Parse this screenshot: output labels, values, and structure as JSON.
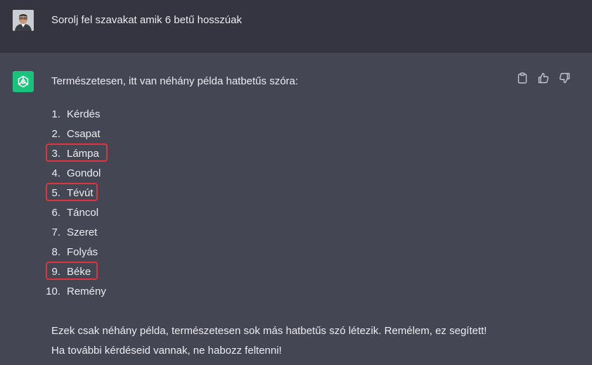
{
  "user": {
    "message": "Sorolj fel szavakat amik 6 betű hosszúak"
  },
  "assistant": {
    "intro": "Természetesen, itt van néhány példa hatbetűs szóra:",
    "items": [
      {
        "num": "1.",
        "word": "Kérdés",
        "highlighted": false
      },
      {
        "num": "2.",
        "word": "Csapat",
        "highlighted": false
      },
      {
        "num": "3.",
        "word": "Lámpa",
        "highlighted": true
      },
      {
        "num": "4.",
        "word": "Gondol",
        "highlighted": false
      },
      {
        "num": "5.",
        "word": "Tévút",
        "highlighted": true
      },
      {
        "num": "6.",
        "word": "Táncol",
        "highlighted": false
      },
      {
        "num": "7.",
        "word": "Szeret",
        "highlighted": false
      },
      {
        "num": "8.",
        "word": "Folyás",
        "highlighted": false
      },
      {
        "num": "9.",
        "word": "Béke",
        "highlighted": true
      },
      {
        "num": "10.",
        "word": "Remény",
        "highlighted": false
      }
    ],
    "outro_line1": "Ezek csak néhány példa, természetesen sok más hatbetűs szó létezik. Remélem, ez segített!",
    "outro_line2": "Ha további kérdéseid vannak, ne habozz feltenni!"
  },
  "icons": {
    "copy": "clipboard-icon",
    "like": "thumbs-up-icon",
    "dislike": "thumbs-down-icon",
    "assistant_logo": "openai-logo-icon"
  },
  "colors": {
    "user_bg": "#343541",
    "assistant_bg": "#444654",
    "logo_bg": "#19c37d",
    "highlight": "#e0343d",
    "text": "#ececf1"
  }
}
